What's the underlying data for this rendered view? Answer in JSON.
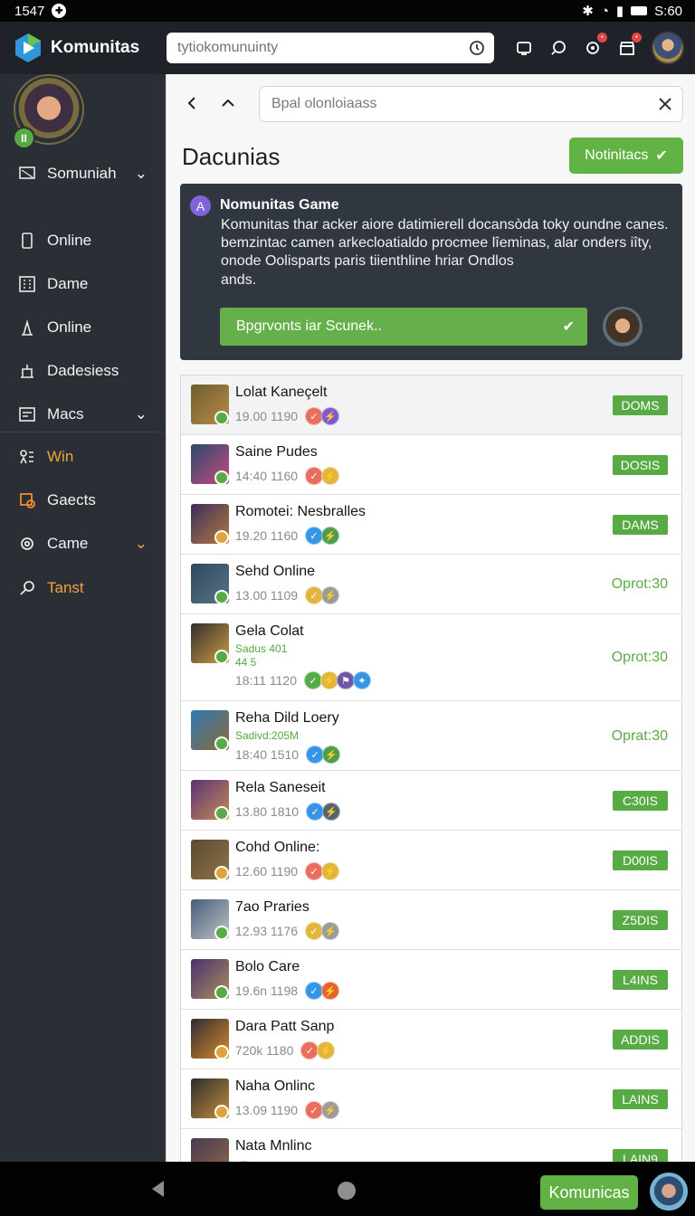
{
  "status_bar": {
    "time": "1547",
    "right_time": "S:60"
  },
  "app": {
    "name": "Komunitas",
    "search_placeholder": "tytiokomunuinty"
  },
  "sidebar": {
    "items": [
      {
        "label": "Somuniah",
        "icon": "chat-icon",
        "has_chevron": true,
        "accent": false
      },
      {
        "label": "Online",
        "icon": "phone-icon",
        "has_chevron": false,
        "accent": false
      },
      {
        "label": "Dame",
        "icon": "grid-icon",
        "has_chevron": false,
        "accent": false
      },
      {
        "label": "Online",
        "icon": "game-controller-icon",
        "has_chevron": false,
        "accent": false
      },
      {
        "label": "Dadesiess",
        "icon": "building-icon",
        "has_chevron": false,
        "accent": false
      },
      {
        "label": "Macs",
        "icon": "calendar-icon",
        "has_chevron": true,
        "accent": false
      },
      {
        "label": "Win",
        "icon": "trophy-icon",
        "has_chevron": false,
        "accent": true
      },
      {
        "label": "Gaects",
        "icon": "gift-icon",
        "has_chevron": false,
        "accent": false
      },
      {
        "label": "Came",
        "icon": "settings-icon",
        "has_chevron": true,
        "accent": false
      },
      {
        "label": "Tanst",
        "icon": "search-icon",
        "has_chevron": false,
        "accent": true
      }
    ]
  },
  "main": {
    "search_placeholder": "Bpal olonloiaass",
    "title": "Dacunias",
    "notification_button": "Notinitacs",
    "card": {
      "avatar_letter": "A",
      "title": "Nomunitas Game",
      "description": "Komunitas thar acker aiore datimierell docansòda toky oundne canes. bemzintac camen arkecloatialdo procmee lîeminas, alar onders iîty, onode Oolisparts paris tiienthline hriar Ondlos",
      "description_suffix": "ands.",
      "support_button": "Bpgrvonts iar Scunek.."
    },
    "rows": [
      {
        "name": "Lolat Kaneçelt",
        "meta": "19.00  1190",
        "chips": [
          "#e86f5d",
          "#7f59d3"
        ],
        "status": "DOMS",
        "status_type": "pill",
        "thumb": [
          "#6e5d32",
          "#b88c45"
        ],
        "badge": "#58aa45"
      },
      {
        "name": "Saine Pudes",
        "meta": "14:40  1160",
        "chips": [
          "#e86f5d",
          "#e2b63c"
        ],
        "status": "DOSIS",
        "status_type": "pill",
        "thumb": [
          "#2c496d",
          "#c44a7f"
        ],
        "badge": "#58aa45"
      },
      {
        "name": "Romotei: Nesbralles",
        "meta": "19.20  1160",
        "chips": [
          "#3795e5",
          "#4c9d4d"
        ],
        "status": "DAMS",
        "status_type": "pill",
        "thumb": [
          "#3d2d5c",
          "#b07b3f"
        ],
        "badge": "#e0a23a"
      },
      {
        "name": "Sehd Online",
        "meta": "13.00  1109",
        "chips": [
          "#e2b63c",
          "#9b9b9b"
        ],
        "status": "Oprot:30",
        "status_type": "text",
        "thumb": [
          "#2d4a5d",
          "#5b7387"
        ],
        "badge": "#58aa45"
      },
      {
        "name": "Gela Colat",
        "sub_lines": [
          "Sadus 401",
          "44 5"
        ],
        "meta": "18:11  1120",
        "chips": [
          "#54ac46",
          "#e2b63c",
          "#6c57a6",
          "#3795e5"
        ],
        "status": "Oprot:30",
        "status_type": "text",
        "thumb": [
          "#312d2f",
          "#cf9d43"
        ],
        "badge": "#58aa45"
      },
      {
        "name": "Reha Dild Loery",
        "sub_lines": [
          "Sadivd:205M"
        ],
        "meta": "18:40  1510",
        "chips": [
          "#3795e5",
          "#4c9d4d"
        ],
        "status": "Oprat:30",
        "status_type": "text",
        "thumb": [
          "#2f77b2",
          "#8c6b3c"
        ],
        "badge": "#58aa45"
      },
      {
        "name": "Rela Saneseit",
        "meta": "13.80  1810",
        "chips": [
          "#3795e5",
          "#55656f"
        ],
        "status": "C30IS",
        "status_type": "pill",
        "thumb": [
          "#5a3376",
          "#c58a55"
        ],
        "badge": "#58aa45"
      },
      {
        "name": "Cohd Online:",
        "meta": "12.60  1190",
        "chips": [
          "#e86f5d",
          "#e2b63c"
        ],
        "status": "D00IS",
        "status_type": "pill",
        "thumb": [
          "#5a4934",
          "#8f7547"
        ],
        "badge": "#e0a23a"
      },
      {
        "name": "7ao Praries",
        "meta": "12.93  1176",
        "chips": [
          "#e2b63c",
          "#9b9b9b"
        ],
        "status": "Z5DIS",
        "status_type": "pill",
        "thumb": [
          "#415d7b",
          "#c4c4c4"
        ],
        "badge": "#58aa45"
      },
      {
        "name": "Bolo Care",
        "meta": "19.6n  1198",
        "chips": [
          "#3795e5",
          "#e4642d"
        ],
        "status": "L4INS",
        "status_type": "pill",
        "thumb": [
          "#46336e",
          "#ae8d5d"
        ],
        "badge": "#58aa45"
      },
      {
        "name": "Dara Patt Sanp",
        "meta": "720k  1180",
        "chips": [
          "#e86f5d",
          "#e2b63c"
        ],
        "status": "ADDIS",
        "status_type": "pill",
        "thumb": [
          "#2d2b33",
          "#d98c2c"
        ],
        "badge": "#e0a23a"
      },
      {
        "name": "Naha Onlinc",
        "meta": "13.09  1190",
        "chips": [
          "#e86f5d",
          "#9b9b9b"
        ],
        "status": "LAINS",
        "status_type": "pill",
        "thumb": [
          "#2c2b30",
          "#c3903b"
        ],
        "badge": "#e0a23a"
      },
      {
        "name": "Nata Mnlinc",
        "meta": "",
        "chips": [
          "#3795e5"
        ],
        "status": "LAIN9",
        "status_type": "pill",
        "thumb": [
          "#4b3952",
          "#8a6a46"
        ],
        "badge": "#58aa45"
      }
    ]
  },
  "bottom_bar": {
    "button": "Komunicas"
  },
  "colors": {
    "accent_green": "#61b443",
    "accent_orange": "#f2a23c",
    "sidebar_bg": "#2a2f35",
    "card_bg": "#30373e"
  }
}
